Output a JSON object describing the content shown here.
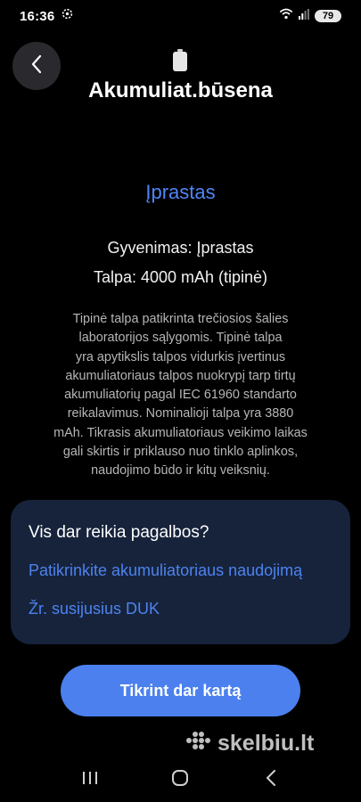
{
  "status_bar": {
    "time": "16:36",
    "battery_level": "79",
    "icons": [
      "gear-icon",
      "wifi-icon",
      "signal-icon",
      "battery-icon"
    ]
  },
  "header": {
    "back_icon": "chevron-left-icon",
    "battery_icon": "battery-icon",
    "title": "Akumuliat.būsena"
  },
  "main": {
    "status": "Įprastas",
    "life_line": "Gyvenimas: Įprastas",
    "capacity_line": "Talpa: 4000 mAh (tipinė)",
    "description_lines": [
      "Tipinė talpa patikrinta trečiosios šalies",
      "laboratorijos sąlygomis. Tipinė talpa",
      "yra apytikslis talpos vidurkis įvertinus",
      "akumuliatoriaus talpos nuokrypį tarp tirtų",
      "akumuliatorių pagal IEC 61960 standarto",
      "reikalavimus. Nominalioji talpa yra 3880",
      "mAh. Tikrasis akumuliatoriaus veikimo laikas",
      "gali skirtis ir priklauso nuo tinklo aplinkos,",
      "naudojimo būdo ir kitų veiksnių."
    ]
  },
  "help_card": {
    "title": "Vis dar reikia pagalbos?",
    "link_usage": "Patikrinkite akumuliatoriaus naudojimą",
    "link_faq": "Žr. susijusius DUK"
  },
  "actions": {
    "check_again": "Tikrint dar kartą"
  },
  "watermark": {
    "text": "skelbiu.lt"
  },
  "nav_bar": {
    "icons": [
      "recent-apps-icon",
      "home-icon",
      "back-icon"
    ]
  },
  "colors": {
    "accent": "#4f86f7",
    "card_bg": "#16233b",
    "button_bg": "#4b80ee",
    "background": "#000000"
  }
}
